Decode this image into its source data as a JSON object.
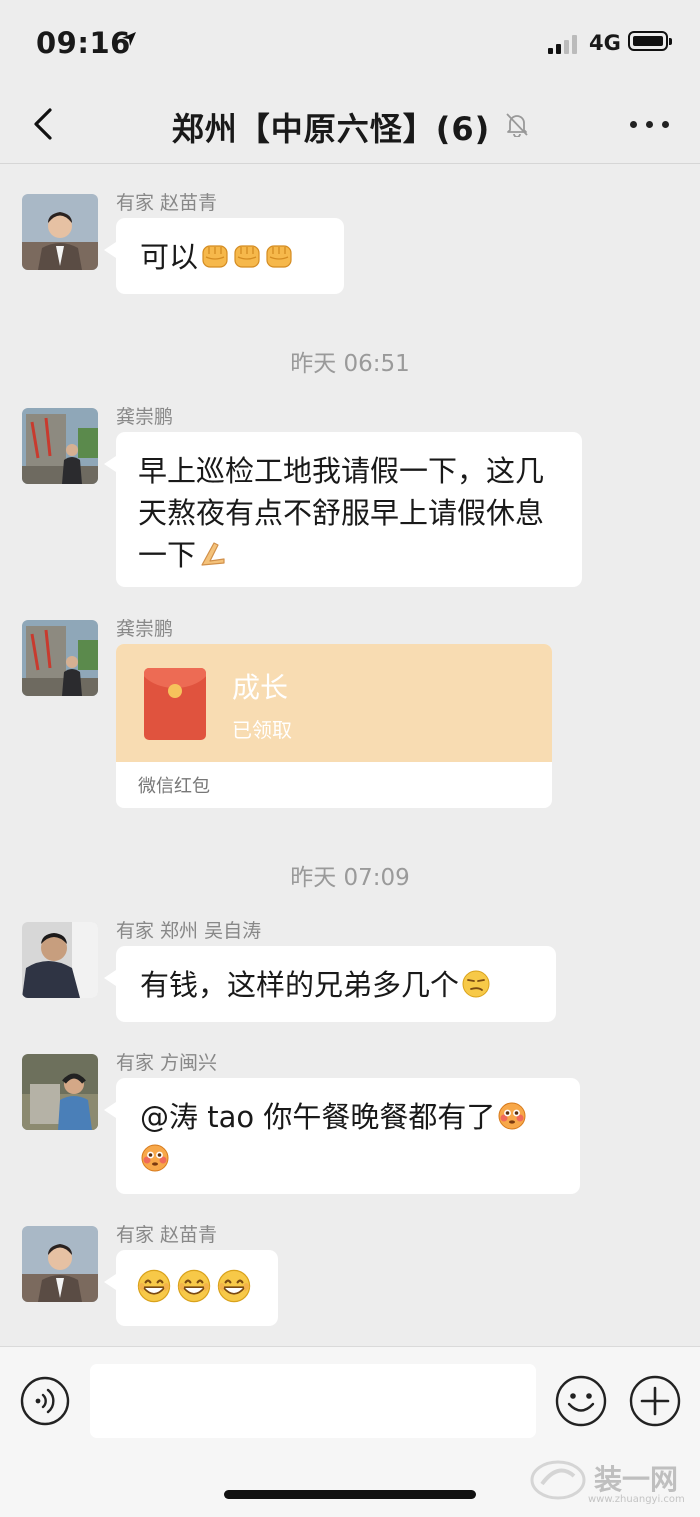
{
  "status_bar": {
    "time": "09:16",
    "network": "4G",
    "signal_bars": 2
  },
  "nav": {
    "title": "郑州【中原六怪】(6)"
  },
  "messages": [
    {
      "type": "text",
      "sender": "有家 赵苗青",
      "text": "可以",
      "emoji": [
        "fist-emoji",
        "fist-emoji",
        "fist-emoji"
      ]
    },
    {
      "type": "timestamp",
      "text": "昨天 06:51"
    },
    {
      "type": "text",
      "sender": "龚崇鹏",
      "text": "早上巡检工地我请假一下，这几天熬夜有点不舒服早上请假休息一下",
      "emoji": [
        "hands-together-emoji"
      ]
    },
    {
      "type": "red_packet",
      "sender": "龚崇鹏",
      "title": "成长",
      "status": "已领取",
      "footer": "微信红包"
    },
    {
      "type": "timestamp",
      "text": "昨天 07:09"
    },
    {
      "type": "text",
      "sender": "有家 郑州 吴自涛",
      "text": "有钱，这样的兄弟多几个",
      "emoji": [
        "smirk-emoji"
      ]
    },
    {
      "type": "text",
      "sender": "有家 方闽兴",
      "text": "@涛 tao 你午餐晚餐都有了",
      "emoji": [
        "flushed-emoji",
        "flushed-emoji"
      ]
    },
    {
      "type": "text",
      "sender": "有家 赵苗青",
      "text": "",
      "emoji": [
        "grin-sweat-emoji",
        "grin-sweat-emoji",
        "grin-sweat-emoji"
      ]
    }
  ],
  "watermark": {
    "brand": "装一网",
    "url": "www.zhuangyi.com"
  },
  "colors": {
    "background": "#ededed",
    "bubble": "#ffffff",
    "red_packet": "#f8dcb2",
    "envelope": "#e0533e"
  }
}
